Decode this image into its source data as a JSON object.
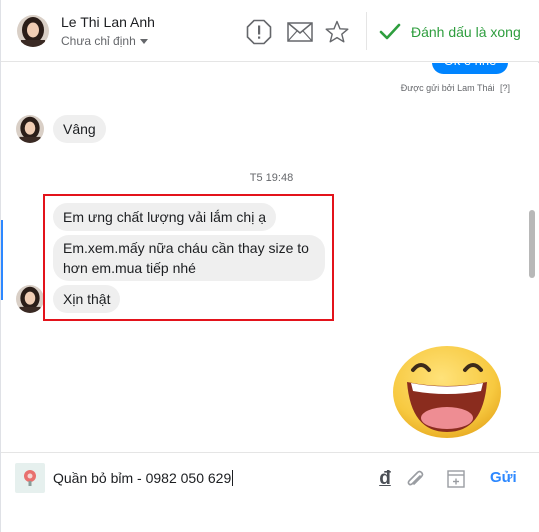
{
  "header": {
    "contact_name": "Le Thi Lan Anh",
    "assign_label": "Chưa chỉ định",
    "done_label": "Đánh dấu là xong",
    "icons": [
      "alert-icon",
      "mail-icon",
      "star-icon",
      "check-icon"
    ]
  },
  "conversation": {
    "sent_bubble_text": "Ok e nhe",
    "sent_by": "Được gửi bởi Lam Thái",
    "sent_by_suffix": "[?]",
    "reply_1": "Vâng",
    "timestamp": "T5 19:48",
    "messages": [
      "Em ưng chất lượng vải lắm chị ạ",
      "Em.xem.mấy nữa cháu cần thay size to hơn em.mua tiếp nhé",
      "Xịn thật"
    ],
    "sticker": "laughing-face-sticker"
  },
  "composer": {
    "input_value": "Quần bỏ bỉm - 0982 050 629",
    "currency_symbol": "đ",
    "send_label": "Gửi"
  },
  "colors": {
    "accent_blue": "#2d88ff",
    "done_green": "#2e9e3e",
    "highlight_red": "#e3131b",
    "bubble_gray": "#efefef"
  }
}
